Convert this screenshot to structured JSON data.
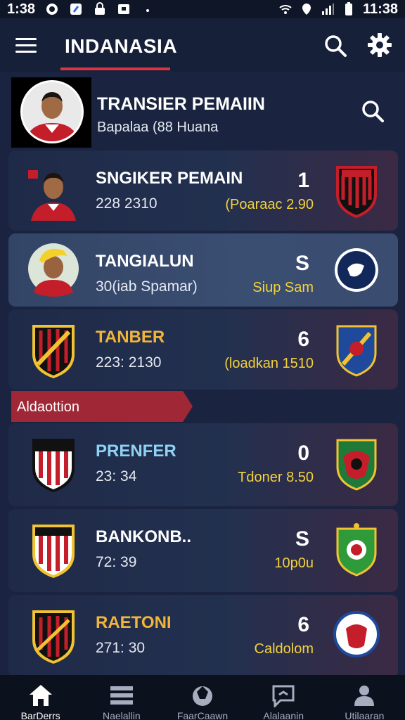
{
  "status_bar": {
    "time_left": "1:38",
    "time_right": "11:38"
  },
  "app_bar": {
    "title": "INDANASIA"
  },
  "profile": {
    "title": "TRANSIER PEMAIIN",
    "subtitle": "Bapalaa (88 Huana"
  },
  "section": {
    "label": "Aldaottion"
  },
  "transfers": [
    {
      "name": "SNGIKER PEMAIN",
      "time": "228 2310",
      "number": "1",
      "detail": "(Poaraac 2.90",
      "name_color": "white",
      "highlight": false
    },
    {
      "name": "TANGIALUN",
      "time": "30(iab Spamar)",
      "number": "S",
      "detail": "Siup Sam",
      "name_color": "white",
      "highlight": true
    },
    {
      "name": "TANBER",
      "time": "223: 2130",
      "number": "6",
      "detail": "(loadkan 1510",
      "name_color": "gold",
      "highlight": false
    },
    {
      "name": "PRENFER",
      "time": "23: 34",
      "number": "0",
      "detail": "Tdoner 8.50",
      "name_color": "blue",
      "highlight": false
    },
    {
      "name": "BANKONB..",
      "time": "72: 39",
      "number": "S",
      "detail": "10p0u",
      "name_color": "white",
      "highlight": false
    },
    {
      "name": "RAETONI",
      "time": "271: 30",
      "number": "6",
      "detail": "Caldolom",
      "name_color": "gold",
      "highlight": false
    }
  ],
  "bottom_nav": [
    {
      "label": "BarDerrs",
      "icon": "home-icon"
    },
    {
      "label": "Naelallin",
      "icon": "list-icon"
    },
    {
      "label": "FaarCaawn",
      "icon": "ball-icon"
    },
    {
      "label": "Alalaanin",
      "icon": "chat-icon"
    },
    {
      "label": "Utilaaran",
      "icon": "person-icon"
    }
  ],
  "colors": {
    "accent": "#d93640",
    "gold": "#f1b53c",
    "yellow": "#f4d23c",
    "light_blue": "#8fd2f4",
    "background": "#1a2440"
  }
}
